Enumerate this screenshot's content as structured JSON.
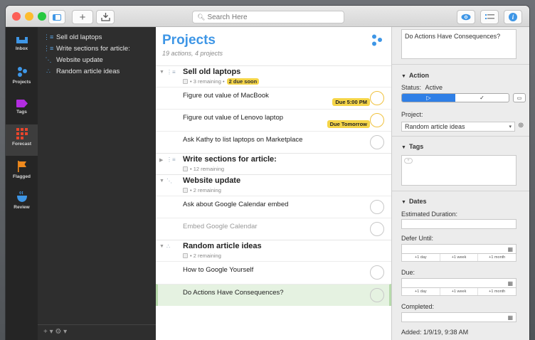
{
  "toolbar": {
    "search_placeholder": "Search Here"
  },
  "tabs": [
    {
      "label": "Inbox",
      "icon": "inbox-icon"
    },
    {
      "label": "Projects",
      "icon": "projects-icon"
    },
    {
      "label": "Tags",
      "icon": "tag-icon"
    },
    {
      "label": "Forecast",
      "icon": "forecast-icon"
    },
    {
      "label": "Flagged",
      "icon": "flag-icon"
    },
    {
      "label": "Review",
      "icon": "review-icon"
    }
  ],
  "sidebar": {
    "items": [
      {
        "label": "Sell old laptops"
      },
      {
        "label": "Write sections for article:"
      },
      {
        "label": "Website update"
      },
      {
        "label": "Random article ideas"
      }
    ],
    "footer": "+ ▾  ⚙ ▾"
  },
  "main": {
    "title": "Projects",
    "subtitle": "19 actions, 4 projects",
    "groups": [
      {
        "name": "Sell old laptops",
        "remaining": "• 3 remaining •",
        "due_soon": "2 due soon"
      },
      {
        "name": "Write sections for article:",
        "remaining": "• 12 remaining"
      },
      {
        "name": "Website update",
        "remaining": "• 2 remaining"
      },
      {
        "name": "Random article ideas",
        "remaining": "• 2 remaining"
      }
    ],
    "tasks": [
      {
        "name": "Figure out value of MacBook",
        "badge": "Due 5:00 PM"
      },
      {
        "name": "Figure out value of Lenovo laptop",
        "badge": "Due Tomorrow"
      },
      {
        "name": "Ask Kathy to list laptops on Marketplace"
      },
      {
        "name": "Ask about Google Calendar embed"
      },
      {
        "name": "Embed Google Calendar"
      },
      {
        "name": "How to Google Yourself"
      },
      {
        "name": "Do Actions Have Consequences?"
      }
    ]
  },
  "inspector": {
    "title_value": "Do Actions Have Consequences?",
    "action_header": "Action",
    "status_label": "Status:",
    "status_value": "Active",
    "seg_active": "▷",
    "seg_done": "✓",
    "seg_dropped": "▭",
    "project_label": "Project:",
    "project_value": "Random article ideas",
    "tags_header": "Tags",
    "dates_header": "Dates",
    "estimated_label": "Estimated Duration:",
    "defer_label": "Defer Until:",
    "due_label": "Due:",
    "completed_label": "Completed:",
    "quick": [
      "+1 day",
      "+1 week",
      "+1 month"
    ],
    "added": "Added:  1/9/19, 9:38 AM"
  },
  "colors": {
    "accent": "#3e96e6",
    "due_yellow": "#f5d548",
    "selected_green": "#e5f2e1"
  }
}
